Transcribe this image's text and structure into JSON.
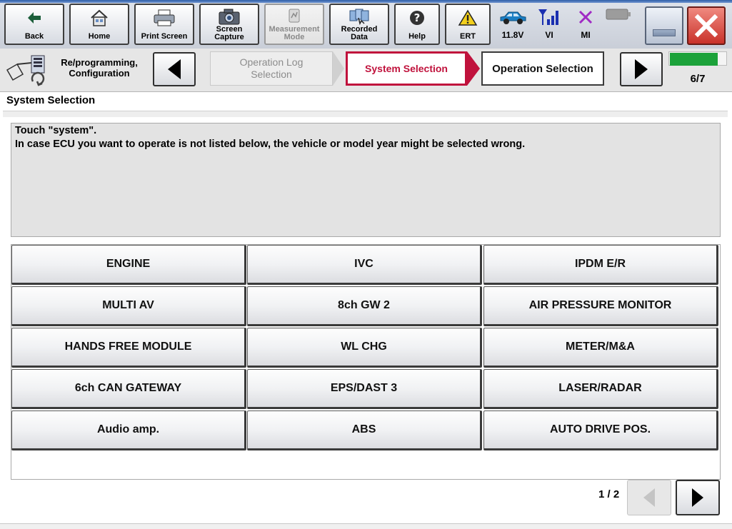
{
  "toolbar": {
    "back_label": "Back",
    "home_label": "Home",
    "print_label": "Print Screen",
    "capture_label_1": "Screen",
    "capture_label_2": "Capture",
    "measurement_label_1": "Measurement",
    "measurement_label_2": "Mode",
    "recorded_label_1": "Recorded",
    "recorded_label_2": "Data",
    "help_label": "Help",
    "ert_label": "ERT"
  },
  "status": {
    "battery_voltage": "11.8V",
    "vi_label": "VI",
    "mi_label": "MI"
  },
  "breadcrumb": {
    "mode_label_1": "Re/programming,",
    "mode_label_2": "Configuration",
    "step1_line1": "Operation Log",
    "step1_line2": "Selection",
    "step2": "System Selection",
    "step3": "Operation Selection",
    "progress": "6/7",
    "progress_fraction": 0.857
  },
  "section_title": "System Selection",
  "instruction": {
    "line1": "Touch \"system\".",
    "line2": "In case ECU you want to operate is not listed below, the vehicle or model year might be selected wrong."
  },
  "systems": [
    "ENGINE",
    "IVC",
    "IPDM E/R",
    "MULTI AV",
    "8ch GW 2",
    "AIR PRESSURE MONITOR",
    "HANDS FREE MODULE",
    "WL CHG",
    "METER/M&A",
    "6ch CAN GATEWAY",
    "EPS/DAST 3",
    "LASER/RADAR",
    "Audio amp.",
    "ABS",
    "AUTO DRIVE POS."
  ],
  "pagination": {
    "page": "1 / 2"
  },
  "colors": {
    "accent": "#c0123c",
    "progress": "#1ca23a",
    "close": "#c9322a"
  },
  "icons": [
    "back-arrow-icon",
    "home-icon",
    "printer-icon",
    "camera-icon",
    "measurement-icon",
    "recorded-data-icon",
    "help-icon",
    "warning-icon",
    "car-icon",
    "signal-icon",
    "mi-cross-icon",
    "battery-icon",
    "minimize-icon",
    "close-icon",
    "reprogramming-icon",
    "triangle-left-icon",
    "triangle-right-icon"
  ]
}
